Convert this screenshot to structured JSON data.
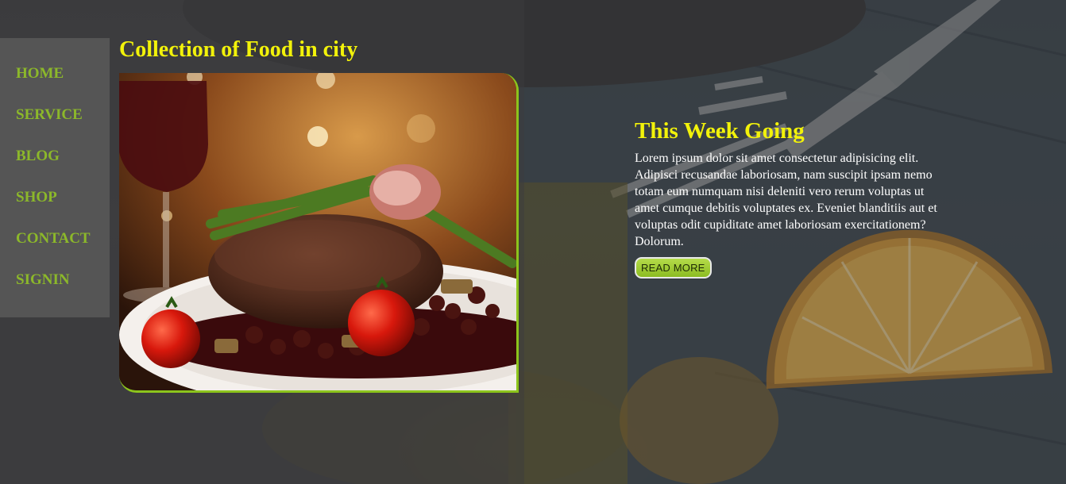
{
  "nav": {
    "items": [
      {
        "label": "HOME"
      },
      {
        "label": "SERVICE"
      },
      {
        "label": "BLOG"
      },
      {
        "label": "SHOP"
      },
      {
        "label": "CONTACT"
      },
      {
        "label": "SIGNIN"
      }
    ]
  },
  "page": {
    "title": "Collection of Food in city"
  },
  "article": {
    "heading": "This Week Going",
    "body": "Lorem ipsum dolor sit amet consectetur adipisicing elit. Adipisci recusandae laboriosam, nam suscipit ipsam nemo totam eum numquam nisi deleniti vero rerum voluptas ut amet cumque debitis voluptates ex. Eveniet blanditiis aut et voluptas odit cupiditate amet laboriosam exercitationem? Dolorum.",
    "button_label": "READ MORE"
  },
  "colors": {
    "nav_text": "#8cb82a",
    "heading": "#f2f20a",
    "button": "#9ccc2e",
    "sidebar_bg": "#555555"
  },
  "images": {
    "feature": "steak-dinner-photo",
    "background": "dining-table-fork-orange-photo"
  }
}
